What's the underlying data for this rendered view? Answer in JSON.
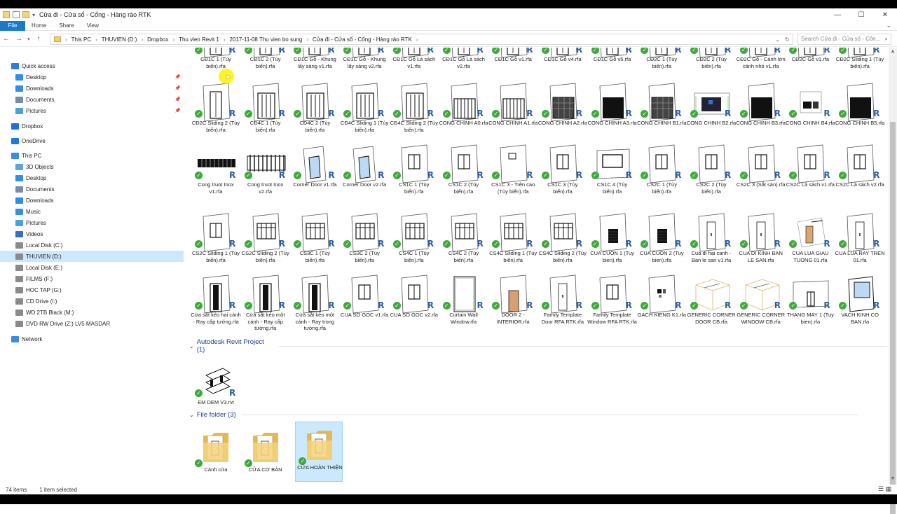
{
  "title": "Cửa đi - Cửa sổ - Cổng - Hàng rào RTK",
  "window_controls": [
    "—",
    "☐",
    "✕"
  ],
  "ribbon": {
    "tabs": [
      "File",
      "Home",
      "Share",
      "View"
    ],
    "expand": "⌄"
  },
  "address": {
    "crumbs": [
      "This PC",
      "THUVIEN (D:)",
      "Dropbox",
      "Thu vien Revit 1",
      "2017-11-08 Thu vien bo sung",
      "Cửa đi - Cửa sổ - Cổng - Hàng rào RTK"
    ],
    "search_placeholder": "Search Cửa đi - Cửa sổ - Cổn...",
    "icons": {
      "back": "back-arrow-icon",
      "forward": "forward-arrow-icon",
      "recent": "chevron-down-icon",
      "up": "up-arrow-icon"
    }
  },
  "nav": {
    "items": [
      {
        "label": "Quick access",
        "icon": "star",
        "color": "#2b7de0",
        "indent": 0,
        "pin": false
      },
      {
        "label": "Desktop",
        "icon": "desktop",
        "color": "#2f8fe6",
        "indent": 1,
        "pin": true
      },
      {
        "label": "Downloads",
        "icon": "download",
        "color": "#2f8fe6",
        "indent": 1,
        "pin": true
      },
      {
        "label": "Documents",
        "icon": "document",
        "color": "#7a8aa8",
        "indent": 1,
        "pin": true
      },
      {
        "label": "Pictures",
        "icon": "picture",
        "color": "#4aa3d8",
        "indent": 1,
        "pin": true
      },
      {
        "label": "Dropbox",
        "icon": "dropbox",
        "color": "#1f6fe0",
        "indent": 0,
        "pin": false
      },
      {
        "label": "OneDrive",
        "icon": "cloud",
        "color": "#1d7be0",
        "indent": 0,
        "pin": false
      },
      {
        "label": "This PC",
        "icon": "computer",
        "color": "#3a8ee0",
        "indent": 0,
        "pin": false
      },
      {
        "label": "3D Objects",
        "icon": "cube",
        "color": "#5aa4e0",
        "indent": 1,
        "pin": false
      },
      {
        "label": "Desktop",
        "icon": "desktop",
        "color": "#2f8fe6",
        "indent": 1,
        "pin": false
      },
      {
        "label": "Documents",
        "icon": "document",
        "color": "#7a8aa8",
        "indent": 1,
        "pin": false
      },
      {
        "label": "Downloads",
        "icon": "download",
        "color": "#2f8fe6",
        "indent": 1,
        "pin": false
      },
      {
        "label": "Music",
        "icon": "music",
        "color": "#3a8ee0",
        "indent": 1,
        "pin": false
      },
      {
        "label": "Pictures",
        "icon": "picture",
        "color": "#4aa3d8",
        "indent": 1,
        "pin": false
      },
      {
        "label": "Videos",
        "icon": "video",
        "color": "#3a6fc0",
        "indent": 1,
        "pin": false
      },
      {
        "label": "Local Disk (C:)",
        "icon": "drive",
        "color": "#8a8a8a",
        "indent": 1,
        "pin": false
      },
      {
        "label": "THUVIEN (D:)",
        "icon": "drive",
        "color": "#8a8a8a",
        "indent": 1,
        "pin": false,
        "selected": true
      },
      {
        "label": "Local Disk (E:)",
        "icon": "drive",
        "color": "#8a8a8a",
        "indent": 1,
        "pin": false
      },
      {
        "label": "FILMS (F:)",
        "icon": "drive",
        "color": "#8a8a8a",
        "indent": 1,
        "pin": false
      },
      {
        "label": "HOC TAP (G:)",
        "icon": "drive",
        "color": "#8a8a8a",
        "indent": 1,
        "pin": false
      },
      {
        "label": "CD Drive (I:)",
        "icon": "cd",
        "color": "#8a8a8a",
        "indent": 1,
        "pin": false
      },
      {
        "label": "WD 2TB Black (M:)",
        "icon": "drive",
        "color": "#8a8a8a",
        "indent": 1,
        "pin": false
      },
      {
        "label": "DVD RW Drive (Z:) LV5 MASDAR",
        "icon": "cd",
        "color": "#8a8a8a",
        "indent": 1,
        "pin": false
      },
      {
        "label": "Network",
        "icon": "network",
        "color": "#3a8ee0",
        "indent": 0,
        "pin": false
      }
    ]
  },
  "files": [
    {
      "label": "CĐ1C 1 (Tùy biến).rfa",
      "thumb": "door"
    },
    {
      "label": "CĐ1C 2 (Tùy biến).rfa",
      "thumb": "door"
    },
    {
      "label": "CĐ1C Gỗ - Khung lấy sáng v1.rfa",
      "thumb": "door"
    },
    {
      "label": "CĐ1C Gỗ - Khung lấy sáng v2.rfa",
      "thumb": "door"
    },
    {
      "label": "CĐ1C Gỗ Lá sách v1.rfa",
      "thumb": "door"
    },
    {
      "label": "CĐ1C Gỗ Lá sách v2.rfa",
      "thumb": "door"
    },
    {
      "label": "CĐ1C Gỗ v1.rfa",
      "thumb": "door"
    },
    {
      "label": "CĐ1C Gỗ v4.rfa",
      "thumb": "door"
    },
    {
      "label": "CĐ1C Gỗ v5.rfa",
      "thumb": "door"
    },
    {
      "label": "CĐ2C 1 (Tùy biến).rfa",
      "thumb": "door"
    },
    {
      "label": "CĐ2C 2 (Tùy biến).rfa",
      "thumb": "door"
    },
    {
      "label": "CĐ2C Gỗ - Cánh lớn cánh nhỏ v1.rfa",
      "thumb": "door"
    },
    {
      "label": "CĐ2C Gỗ v1.rfa",
      "thumb": "door"
    },
    {
      "label": "CĐ2C Sliding 1 (Tùy biến).rfa",
      "thumb": "door"
    },
    {
      "label": "CĐ2C Sliding 2 (Tùy biến).rfa",
      "thumb": "door"
    },
    {
      "label": "CĐ4C 1 (Tùy biến).rfa",
      "thumb": "door4"
    },
    {
      "label": "CĐ4C 2 (Tùy biến).rfa",
      "thumb": "door4"
    },
    {
      "label": "CĐ4C Sliding 1 (Tùy biến).rfa",
      "thumb": "door4"
    },
    {
      "label": "CĐ4C Sliding 2 (Tùy biến).rfa",
      "thumb": "door4"
    },
    {
      "label": "CONG CHINH A0.rfa",
      "thumb": "gate"
    },
    {
      "label": "CONG CHINH A1.rfa",
      "thumb": "gate"
    },
    {
      "label": "CONG CHINH A2.rfa",
      "thumb": "gatedark"
    },
    {
      "label": "CONG CHINH A3.rfa",
      "thumb": "gateblack"
    },
    {
      "label": "CONG CHINH B1.rfa",
      "thumb": "gatedark"
    },
    {
      "label": "CONG CHINH B2.rfa",
      "thumb": "gatecolor"
    },
    {
      "label": "CONG CHINH B3.rfa",
      "thumb": "gateblack"
    },
    {
      "label": "CONG CHINH B4.rfa",
      "thumb": "gatesmall"
    },
    {
      "label": "CONG CHINH B5.rfa",
      "thumb": "gateblack"
    },
    {
      "label": "Cong truot Inox v1.rfa",
      "thumb": "fence"
    },
    {
      "label": "Cong truot Inox v2.rfa",
      "thumb": "fence2"
    },
    {
      "label": "Corner Door v1.rfa",
      "thumb": "corner"
    },
    {
      "label": "Corner Door v2.rfa",
      "thumb": "corner"
    },
    {
      "label": "CS1C 1 (Tùy biến).rfa",
      "thumb": "win"
    },
    {
      "label": "CS1C 2 (Tùy biến).rfa",
      "thumb": "win"
    },
    {
      "label": "CS1C 3 - Trên cao (Tùy biến).rfa",
      "thumb": "winhigh"
    },
    {
      "label": "CS1C 3 (Tùy biến).rfa",
      "thumb": "win"
    },
    {
      "label": "CS1C 4 (Tùy biến).rfa",
      "thumb": "winwide"
    },
    {
      "label": "CS2C 1 (Tùy biến).rfa",
      "thumb": "win"
    },
    {
      "label": "CS2C 2 (Tùy biến).rfa",
      "thumb": "win"
    },
    {
      "label": "CS2C 3 (Sắt sàn).rfa",
      "thumb": "win"
    },
    {
      "label": "CS2C Lá sách v1.rfa",
      "thumb": "win"
    },
    {
      "label": "CS2C Lá sách v2.rfa",
      "thumb": "win"
    },
    {
      "label": "CS2C Sliding 1 (Tùy biến).rfa",
      "thumb": "win"
    },
    {
      "label": "CS2C Sliding 2 (Tùy biến).rfa",
      "thumb": "win4"
    },
    {
      "label": "CS3C 1 (Tùy biến).rfa",
      "thumb": "win4"
    },
    {
      "label": "CS3C 2 (Tùy biến).rfa",
      "thumb": "win4"
    },
    {
      "label": "CS4C 1 (Tùy biến).rfa",
      "thumb": "win4"
    },
    {
      "label": "CS4C 2 (Tùy biến).rfa",
      "thumb": "win4"
    },
    {
      "label": "CS4C Sliding 1 (Tùy biến).rfa",
      "thumb": "win4"
    },
    {
      "label": "CS4C Sliding 2 (Tùy biến).rfa",
      "thumb": "win4"
    },
    {
      "label": "CUA CUON 1 (Tuy bien).rfa",
      "thumb": "rollblack"
    },
    {
      "label": "CUA CUON 2 (Tuy bien).rfa",
      "thumb": "rollblack"
    },
    {
      "label": "Cua di hai canh - Ban le san v1.rfa",
      "thumb": "doorthin"
    },
    {
      "label": "CUA DI KINH BAN LE SAN.rfa",
      "thumb": "doorthin"
    },
    {
      "label": "CUA LUA GIAU TUONG 01.rfa",
      "thumb": "pocket"
    },
    {
      "label": "CUA LUA RAY TREN 01.rfa",
      "thumb": "doorthin"
    },
    {
      "label": "Cửa sắt kéo hai cánh - Ray cấp tường.rfa",
      "thumb": "doorblack"
    },
    {
      "label": "Cửa sắt kéo một cánh - Ray cấp tường.rfa",
      "thumb": "doorblack"
    },
    {
      "label": "Cửa sắt kéo một cánh - Ray trong tường.rfa",
      "thumb": "doorblack"
    },
    {
      "label": "CUA SO GOC v1.rfa",
      "thumb": "win"
    },
    {
      "label": "CUA SO GOC v2.rfa",
      "thumb": "win"
    },
    {
      "label": "Curtain Wall Window.rfa",
      "thumb": "curtain"
    },
    {
      "label": "DOOR 2 - INTERIOR.rfa",
      "thumb": "doorwood"
    },
    {
      "label": "Family Template Door RFA RTK.rfa",
      "thumb": "doorthin"
    },
    {
      "label": "Family Template Window RFA RTK.rfa",
      "thumb": "win"
    },
    {
      "label": "GACH KIENG K1.rfa",
      "thumb": "blocks"
    },
    {
      "label": "GENERIC CORNER DOOR CB.rfa",
      "thumb": "box"
    },
    {
      "label": "GENERIC CORNER WINDOW CB.rfa",
      "thumb": "box"
    },
    {
      "label": "THANG MAY 1 (Tuy bien).rfa",
      "thumb": "elevator"
    },
    {
      "label": "VACH KINH CO BAN.rfa",
      "thumb": "glass"
    }
  ],
  "groups": [
    {
      "label": "Autodesk Revit Project (1)"
    },
    {
      "label": "File folder (3)"
    }
  ],
  "projects": [
    {
      "label": "EM DEM V3.rvt"
    }
  ],
  "folders": [
    {
      "label": "Cánh cửa",
      "selected": false
    },
    {
      "label": "CỬA CƠ BẢN",
      "selected": false
    },
    {
      "label": "CỬA HOÀN THIỆN",
      "selected": true
    }
  ],
  "badges": {
    "revit": "R",
    "sync": "✓"
  },
  "status": {
    "count": "74 items",
    "selection": "1 item selected"
  },
  "colors": {
    "file_tab": "#1979ca",
    "selection": "#cce8ff",
    "sync_ok": "#3eaa3a",
    "revit": "#2a5ea8"
  }
}
